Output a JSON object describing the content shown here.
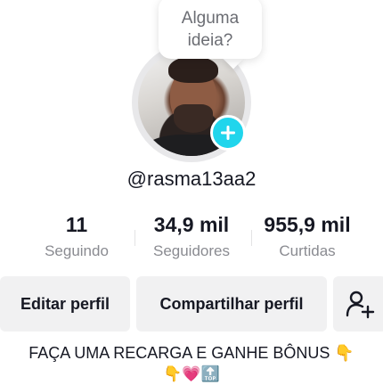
{
  "tooltip": {
    "text": "Alguma\nideia?"
  },
  "profile": {
    "username": "@rasma13aa2"
  },
  "stats": [
    {
      "value": "11",
      "label": "Seguindo"
    },
    {
      "value": "34,9 mil",
      "label": "Seguidores"
    },
    {
      "value": "955,9 mil",
      "label": "Curtidas"
    }
  ],
  "actions": {
    "edit_label": "Editar perfil",
    "share_label": "Compartilhar perfil",
    "add_friend_icon": "add-user-icon"
  },
  "bio": {
    "line1": "FAÇA UMA RECARGA E GANHE BÔNUS 👇",
    "line2": "👇💗🔝"
  },
  "colors": {
    "accent": "#20d5ec",
    "button_bg": "#f1f1f2",
    "muted_text": "#8a8b91"
  }
}
